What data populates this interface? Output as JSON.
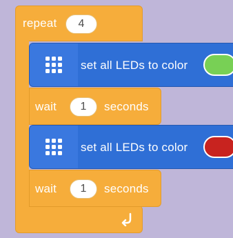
{
  "colors": {
    "background": "#bfb6d9",
    "control_orange": "#f6ad3b",
    "control_orange_dark": "#e39b2a",
    "lights_blue": "#2f6fd6",
    "lights_blue_dark": "#2558b0",
    "icon_area_blue": "#3a78df",
    "green_color": "#78d055",
    "red_color": "#c8231f"
  },
  "repeat": {
    "label": "repeat",
    "count": "4",
    "loop_icon": "loop-arrow-icon"
  },
  "blocks": [
    {
      "type": "led",
      "label": "set all LEDs to color",
      "color_name": "green",
      "icon": "led-grid-icon"
    },
    {
      "type": "wait",
      "label": "wait",
      "value": "1",
      "unit": "seconds"
    },
    {
      "type": "led",
      "label": "set all LEDs to color",
      "color_name": "red",
      "icon": "led-grid-icon"
    },
    {
      "type": "wait",
      "label": "wait",
      "value": "1",
      "unit": "seconds"
    }
  ]
}
